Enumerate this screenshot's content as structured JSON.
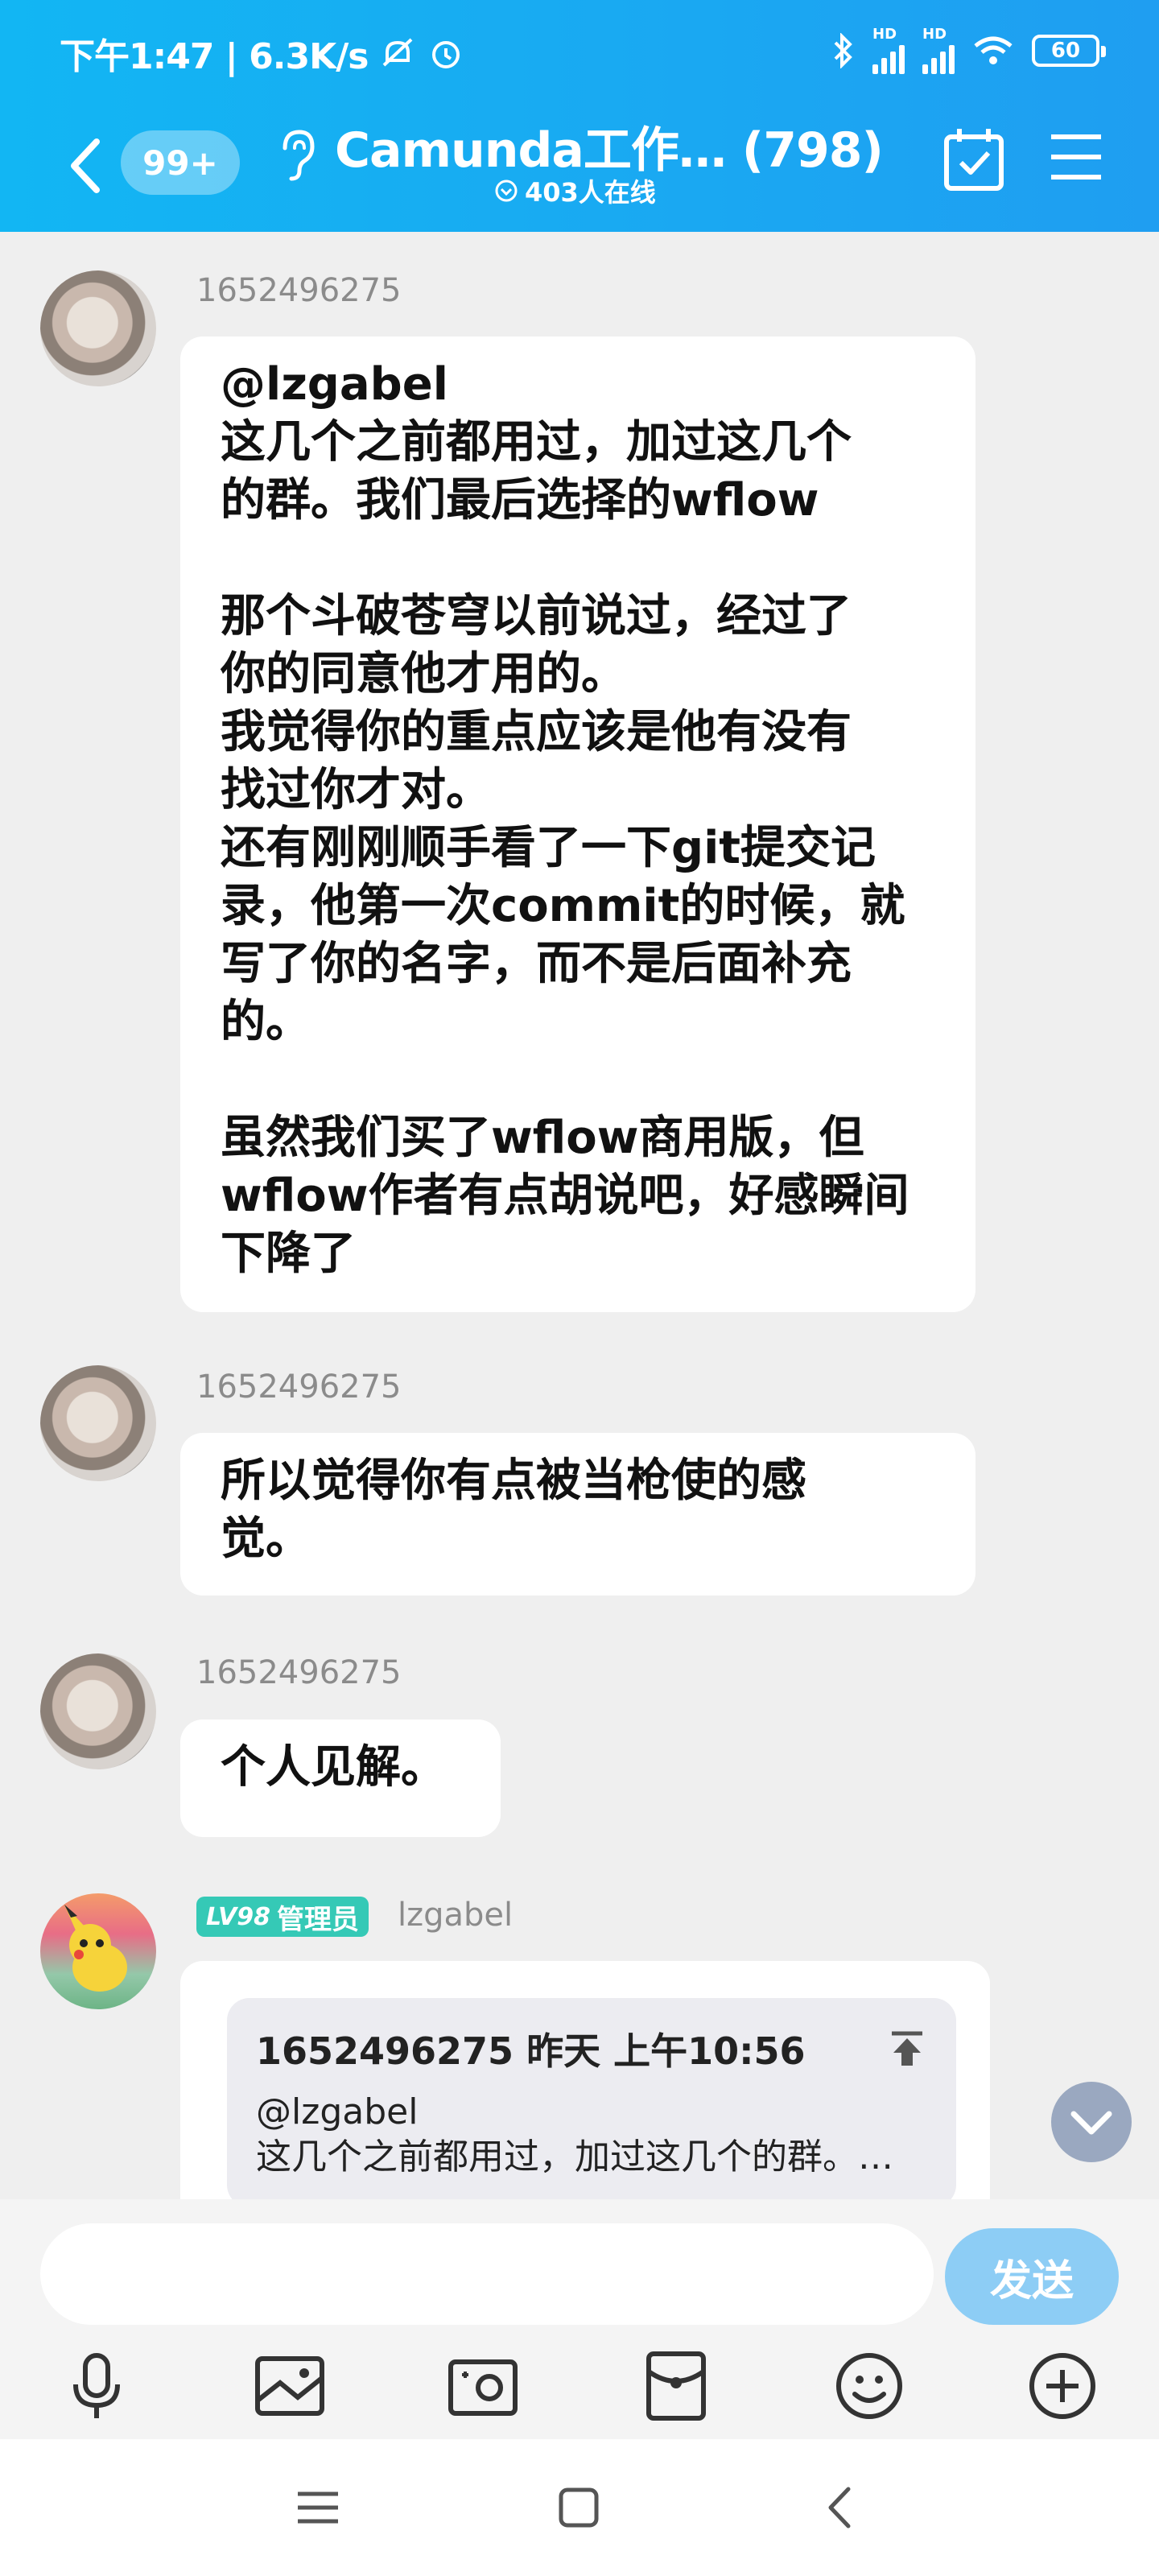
{
  "status_bar": {
    "left_text": "下午1:47 | 6.3K/s",
    "hd1": "HD",
    "hd2": "HD",
    "battery": "60"
  },
  "header": {
    "badge": "99+",
    "title": "Camunda工作… (798)",
    "online": "403人在线"
  },
  "messages": [
    {
      "sender": "1652496275",
      "text": "@lzgabel\n这几个之前都用过，加过这几个\n的群。我们最后选择的wflow\n\n那个斗破苍穹以前说过，经过了\n你的同意他才用的。\n我觉得你的重点应该是他有没有\n找过你才对。\n还有刚刚顺手看了一下git提交记\n录，他第一次commit的时候，就\n写了你的名字，而不是后面补充\n的。\n\n虽然我们买了wflow商用版，但\nwflow作者有点胡说吧，好感瞬间\n下降了"
    },
    {
      "sender": "1652496275",
      "text": "所以觉得你有点被当枪使的感\n觉。"
    },
    {
      "sender": "1652496275",
      "text": "个人见解。"
    }
  ],
  "admin_message": {
    "level": "LV98",
    "role": "管理员",
    "sender": "lzgabel",
    "quote_header": "1652496275 昨天 上午10:56",
    "quote_line1": "@lzgabel",
    "quote_line2": "这几个之前都用过，加过这几个的群。…"
  },
  "input": {
    "placeholder": "",
    "send_label": "发送"
  },
  "icons": [
    "mic-icon",
    "image-icon",
    "camera-icon",
    "red-packet-icon",
    "emoji-icon",
    "plus-icon"
  ],
  "colors": {
    "header_bg": "#12b6f3",
    "send_button": "#8dcdf5",
    "admin_badge": "#35c9b6"
  }
}
